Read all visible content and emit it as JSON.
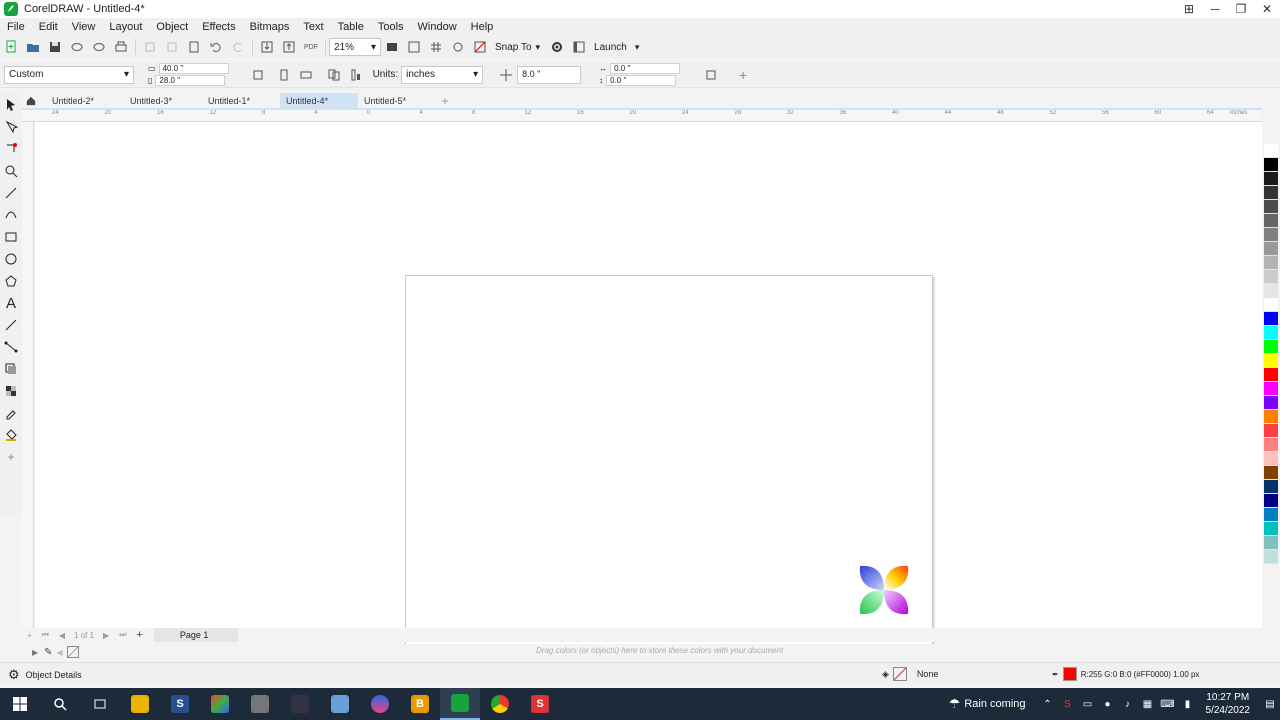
{
  "window": {
    "title": "CorelDRAW - Untitled-4*"
  },
  "menu": [
    "File",
    "Edit",
    "View",
    "Layout",
    "Object",
    "Effects",
    "Bitmaps",
    "Text",
    "Table",
    "Tools",
    "Window",
    "Help"
  ],
  "toolbar": {
    "zoom": "21%",
    "snap_to": "Snap To",
    "launch": "Launch",
    "pdf_label": "PDF"
  },
  "property_bar": {
    "preset": "Custom",
    "width": "40.0 \"",
    "height": "28.0 \"",
    "units_label": "Units:",
    "units_value": "inches",
    "nudge": "8.0 \"",
    "dup_x": "0.0 \"",
    "dup_y": "0.0 \""
  },
  "doc_tabs": [
    {
      "label": "Untitled-2*",
      "active": false
    },
    {
      "label": "Untitled-3*",
      "active": false
    },
    {
      "label": "Untitled-1*",
      "active": false
    },
    {
      "label": "Untitled-4*",
      "active": true
    },
    {
      "label": "Untitled-5*",
      "active": false
    }
  ],
  "ruler_labels": [
    "24",
    "20",
    "16",
    "12",
    "8",
    "4",
    "0",
    "4",
    "8",
    "12",
    "16",
    "20",
    "24",
    "28",
    "32",
    "36",
    "40",
    "44",
    "48",
    "52",
    "56",
    "60",
    "64"
  ],
  "ruler_unit": "inches",
  "page_nav": {
    "counter": "1 of 1",
    "page_name": "Page 1"
  },
  "color_dock_hint": "Drag colors (or objects) here to store these colors with your document",
  "palette_colors": [
    "#ffffff",
    "#000000",
    "#1a1a1a",
    "#333333",
    "#4d4d4d",
    "#666666",
    "#808080",
    "#999999",
    "#b3b3b3",
    "#cccccc",
    "#e6e6e6",
    "#ffffff",
    "#0000ff",
    "#00ffff",
    "#00ff00",
    "#ffff00",
    "#ff0000",
    "#ff00ff",
    "#8000ff",
    "#ff8000",
    "#ff4040",
    "#ff8080",
    "#ffc0c0",
    "#804000",
    "#003366",
    "#000080",
    "#0080c0",
    "#00c0c0",
    "#80c0c0",
    "#c0e0e0"
  ],
  "status": {
    "object_details": "Object Details",
    "fill": "None",
    "outline": "R:255 G:0 B:0 (#FF0000)  1.00 px"
  },
  "taskbar": {
    "weather": "Rain coming",
    "time": "10:27 PM",
    "date": "5/24/2022"
  },
  "colors": {
    "accent": "#1aa33c",
    "tab_active": "#cfe3f5",
    "taskbar": "#1c2a3a"
  }
}
